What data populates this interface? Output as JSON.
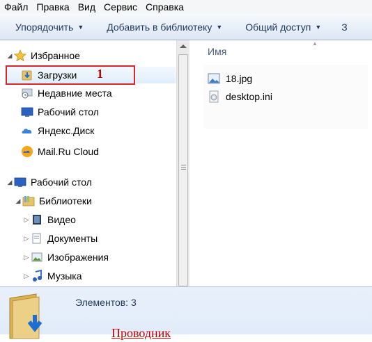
{
  "menu": [
    "Файл",
    "Правка",
    "Вид",
    "Сервис",
    "Справка"
  ],
  "toolbar": {
    "organize": "Упорядочить",
    "add_library": "Добавить в библиотеку",
    "share": "Общий доступ",
    "more": "З"
  },
  "nav": {
    "favorites": "Избранное",
    "downloads": "Загрузки",
    "recent": "Недавние места",
    "desktop_fav": "Рабочий стол",
    "yandex": "Яндекс.Диск",
    "mailru": "Mail.Ru Cloud",
    "desktop": "Рабочий стол",
    "libraries": "Библиотеки",
    "video": "Видео",
    "documents": "Документы",
    "images": "Изображения",
    "music": "Музыка"
  },
  "annotation": {
    "number": "1",
    "caption": "Проводник"
  },
  "content": {
    "column_name": "Имя",
    "files": [
      "18.jpg",
      "desktop.ini"
    ]
  },
  "details": {
    "count": "Элементов: 3"
  },
  "colors": {
    "highlight": "#d9262c",
    "accent": "#1e395b",
    "selection": "#dfeefc"
  }
}
